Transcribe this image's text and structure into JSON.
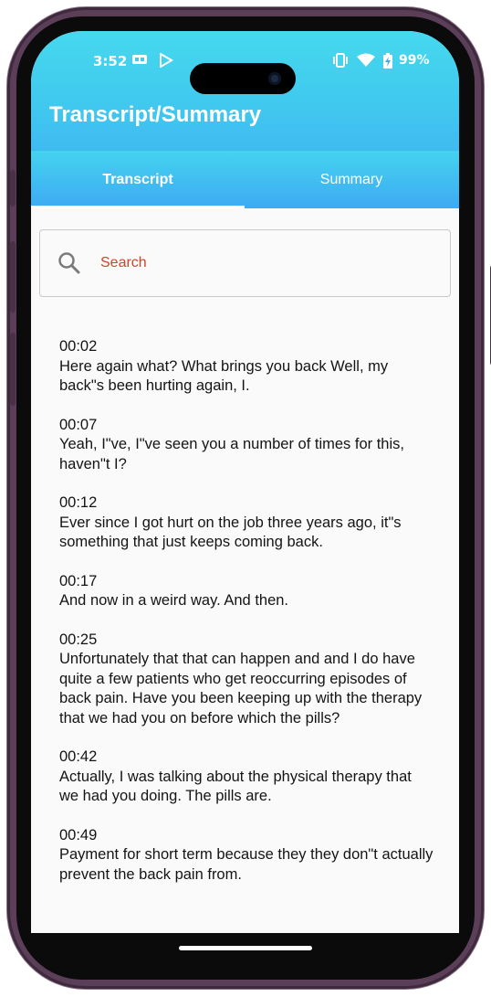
{
  "status_bar": {
    "time": "3:52",
    "icons": [
      "sim-card-icon",
      "play-store-icon",
      "vibrate-icon",
      "wifi-icon",
      "battery-charging-icon"
    ],
    "battery": "99%"
  },
  "app_bar": {
    "title": "Transcript/Summary"
  },
  "tabs": [
    {
      "label": "Transcript",
      "active": true
    },
    {
      "label": "Summary",
      "active": false
    }
  ],
  "search": {
    "placeholder": "Search",
    "value": ""
  },
  "transcript": [
    {
      "time": "00:02",
      "text": "Here again what? What brings you back Well, my back\"s been hurting again, I."
    },
    {
      "time": "00:07",
      "text": "Yeah, I\"ve, I\"ve seen you a number of times for this, haven\"t I?"
    },
    {
      "time": "00:12",
      "text": "Ever since I got hurt on the job three years ago, it\"s something that just keeps coming back."
    },
    {
      "time": "00:17",
      "text": "And now in a weird way. And then."
    },
    {
      "time": "00:25",
      "text": "Unfortunately that that can happen and and I do have quite a few patients who get reoccurring episodes of back pain. Have you been keeping up with the therapy that we had you on before which the pills?"
    },
    {
      "time": "00:42",
      "text": "Actually, I was talking about the physical therapy that we had you doing. The pills are."
    },
    {
      "time": "00:49",
      "text": "Payment for short term because they they don\"t actually prevent the back pain from."
    }
  ],
  "colors": {
    "header_top": "#45d9ee",
    "header_bottom": "#3ea8f3",
    "search_placeholder": "#d0442a",
    "frame": "#5b3f58"
  }
}
